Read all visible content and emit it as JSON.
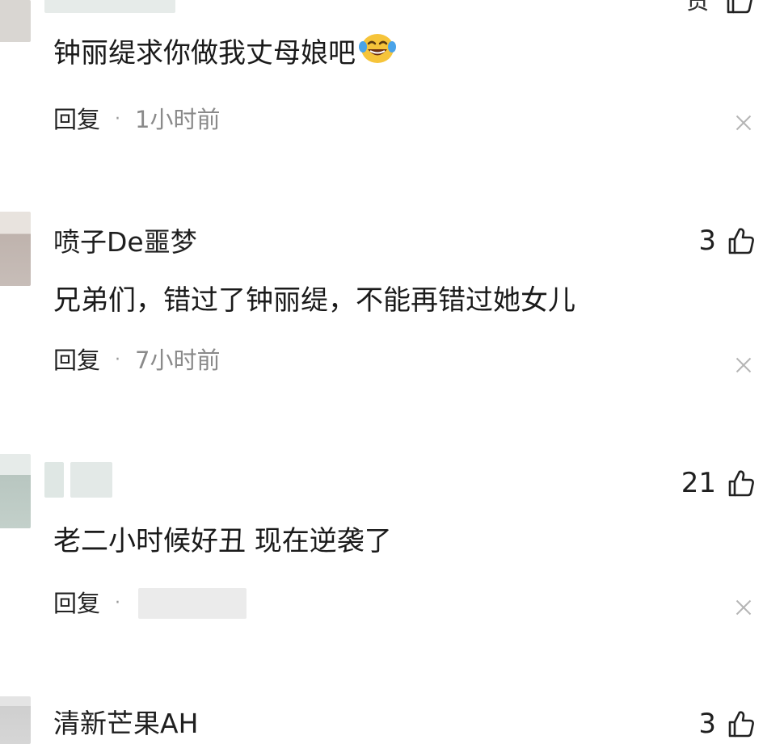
{
  "comments": [
    {
      "username": "",
      "text": "钟丽缇求你做我丈母娘吧",
      "emoji": "laughing-crying-emoji",
      "reply_label": "回复",
      "separator": "·",
      "time": "1小时前",
      "likes": ""
    },
    {
      "username": "喷子De噩梦",
      "text": "兄弟们，错过了钟丽缇，不能再错过她女儿",
      "reply_label": "回复",
      "separator": "·",
      "time": "7小时前",
      "likes": "3"
    },
    {
      "username": "",
      "text": "老二小时候好丑 现在逆袭了",
      "reply_label": "回复",
      "separator": "·",
      "time": "",
      "likes": "21"
    },
    {
      "username": "清新芒果AH",
      "text": "",
      "likes": "3"
    }
  ],
  "top_partial_text": "赞",
  "colors": {
    "text": "#1f1f1f",
    "meta": "#8a8a8a",
    "close": "#b5b5b5",
    "blur_block": "#e3e8e6"
  }
}
